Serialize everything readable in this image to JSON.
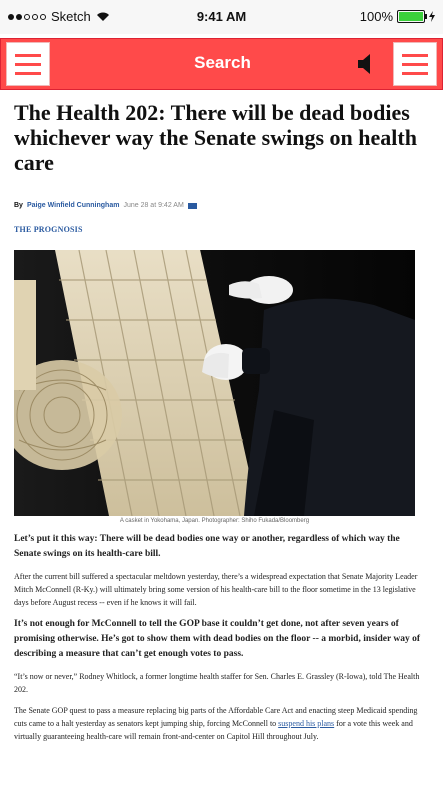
{
  "status_bar": {
    "carrier": "Sketch",
    "time": "9:41 AM",
    "battery": "100%"
  },
  "toolbar": {
    "title": "Search"
  },
  "article": {
    "headline": "The Health 202: There will be dead bodies whichever way the Senate swings on health care",
    "byline_prefix": "By",
    "author": "Paige Winfield Cunningham",
    "date": "June 28 at 9:42 AM",
    "kicker": "THE PROGNOSIS",
    "caption": "A casket in  Yokohama, Japan. Photographer: Shiho Fukada/Bloomberg",
    "paragraphs": {
      "p1": "Let’s put it this way: There will be dead bodies one way or another, regardless of which way the Senate swings on its health-care bill.",
      "p2": "After the current bill suffered a spectacular meltdown yesterday, there’s a widespread expectation that Senate Majority Leader Mitch McConnell (R-Ky.) will ultimately bring some version of his health-care bill to the floor sometime in the 13 legislative days before August recess -- even if he knows it will fail.",
      "p3": "It’s not enough for McConnell to tell the GOP base it couldn’t get done, not after seven years of promising otherwise. He’s got to show them with dead bodies on the floor -- a morbid, insider way of describing a measure that can’t get enough votes to pass.",
      "p4": "“It’s now or never,” Rodney Whitlock, a former longtime health staffer for Sen. Charles E. Grassley (R-Iowa), told The Health 202.",
      "p5_before": "The Senate GOP quest to pass a measure replacing big parts of the Affordable Care Act and enacting steep Medicaid spending cuts came to a halt yesterday as senators kept jumping ship, forcing McConnell to ",
      "p5_link": "suspend his plans",
      "p5_after": " for a vote this week and virtually guaranteeing health-care will remain front-and-center on Capitol Hill throughout July."
    }
  }
}
